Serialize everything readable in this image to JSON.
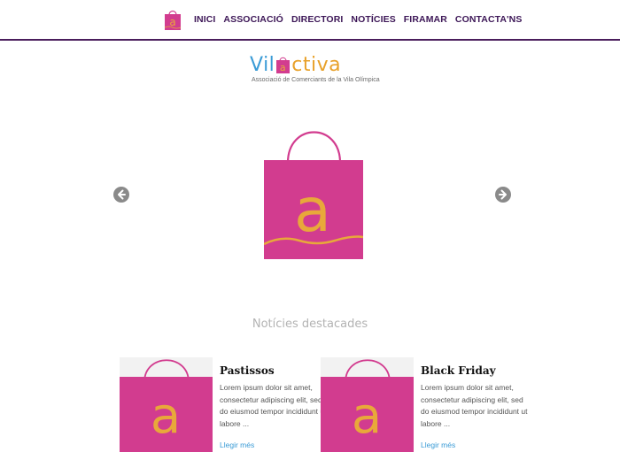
{
  "nav": {
    "logo_icon": "bag-a-logo-icon",
    "items": [
      {
        "label": "INICI"
      },
      {
        "label": "ASSOCIACIÓ"
      },
      {
        "label": "DIRECTORI"
      },
      {
        "label": "NOTÍCIES"
      },
      {
        "label": "FIRAMAR"
      },
      {
        "label": "CONTACTA'NS"
      }
    ]
  },
  "brand": {
    "word_left": "Vil",
    "word_mid": "a",
    "word_right": "ctiva",
    "subtitle": "Associació de Comerciants de la Vila Olímpica"
  },
  "slider": {
    "prev_icon": "arrow-left-icon",
    "next_icon": "arrow-right-icon",
    "slide_icon": "shopping-bag-a-icon"
  },
  "featured": {
    "title": "Notícies destacades",
    "cards": [
      {
        "title": "Pastissos",
        "excerpt": "Lorem ipsum dolor sit amet, consectetur adipiscing elit, sed do eiusmod tempor incididunt ut labore ...",
        "link": "Llegir més"
      },
      {
        "title": "Black Friday",
        "excerpt": "Lorem ipsum dolor sit amet, consectetur adipiscing elit, sed do eiusmod tempor incididunt ut labore ...",
        "link": "Llegir més"
      }
    ]
  },
  "colors": {
    "bag_pink": "#d23c8f",
    "bag_letter": "#e8a83a",
    "nav_text": "#3d1757",
    "brand_blue": "#3a9bd6",
    "brand_orange": "#e8a12a"
  }
}
